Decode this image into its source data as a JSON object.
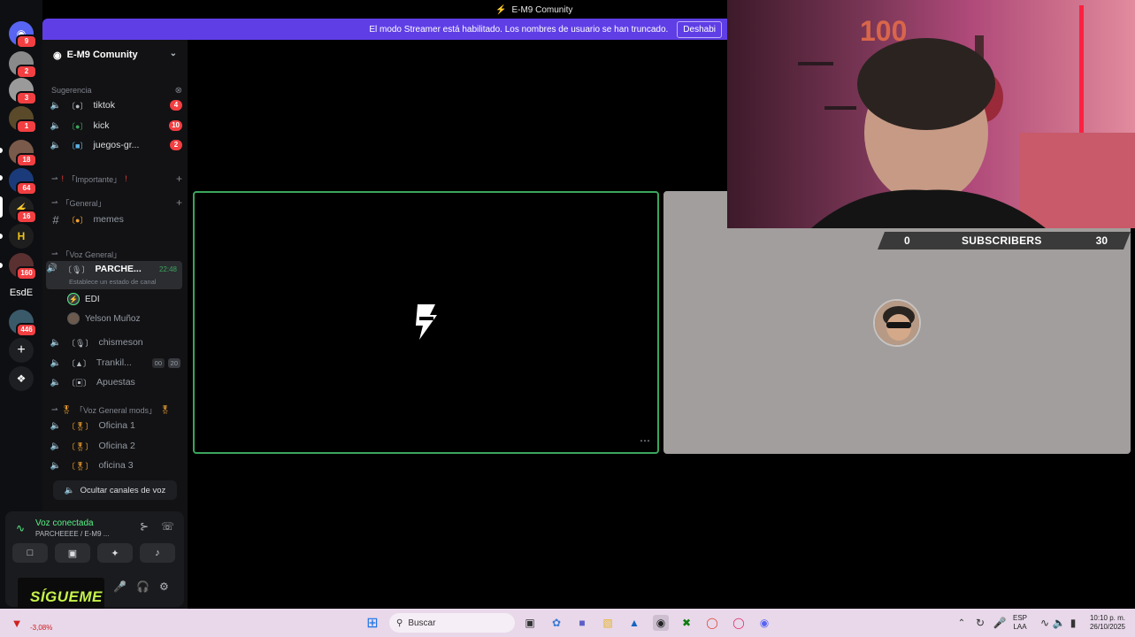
{
  "window": {
    "title": "E-M9 Comunity"
  },
  "banner": {
    "text": "El modo Streamer está habilitado. Los nombres de usuario se han truncado.",
    "button": "Deshabi"
  },
  "servers": [
    {
      "badge": "9"
    },
    {
      "badge": "2"
    },
    {
      "badge": "3"
    },
    {
      "badge": "1"
    },
    {
      "badge": "18"
    },
    {
      "badge": "64"
    },
    {
      "badge": "16"
    },
    {
      "badge": ""
    },
    {
      "badge": "160"
    },
    {
      "label": "EsdE"
    },
    {
      "badge": "446"
    }
  ],
  "guild": {
    "name": "E-M9 Comunity"
  },
  "suggestion": {
    "label": "Sugerencia",
    "channels": [
      {
        "name": "tiktok",
        "count": "4"
      },
      {
        "name": "kick",
        "count": "10"
      },
      {
        "name": "juegos-gr...",
        "count": "2"
      }
    ]
  },
  "categories": {
    "importante": "「Importante」",
    "general": "「General」",
    "voz_general": "「Voz General」",
    "voz_mods": "「Voz General mods」"
  },
  "text_channels": [
    {
      "name": "memes"
    }
  ],
  "voice": {
    "active": {
      "name": "PARCHE...",
      "time": "22:48",
      "status": "Establece un estado de canal"
    },
    "members": [
      {
        "name": "EDI"
      },
      {
        "name": "Yelson Muñoz"
      }
    ],
    "channels": [
      {
        "name": "chismeson"
      },
      {
        "name": "Trankil...",
        "a": "00",
        "b": "20"
      },
      {
        "name": "Apuestas"
      }
    ],
    "mods": [
      {
        "name": "Oficina 1"
      },
      {
        "name": "Oficina 2"
      },
      {
        "name": "oficina 3"
      }
    ],
    "hide_button": "Ocultar canales de voz"
  },
  "connection": {
    "status": "Voz conectada",
    "channel": "PARCHEEEE / E-M9 ..."
  },
  "overlay": {
    "sigueme": "SÍGUEME",
    "subs_current": "0",
    "subs_label": "SUBSCRIBERS",
    "subs_goal": "30"
  },
  "taskbar": {
    "search": "Buscar",
    "lang": "ESP",
    "layout": "LAA",
    "time": "10:10 p. m.",
    "date": "26/10/2025",
    "stock": "-3,08%"
  }
}
